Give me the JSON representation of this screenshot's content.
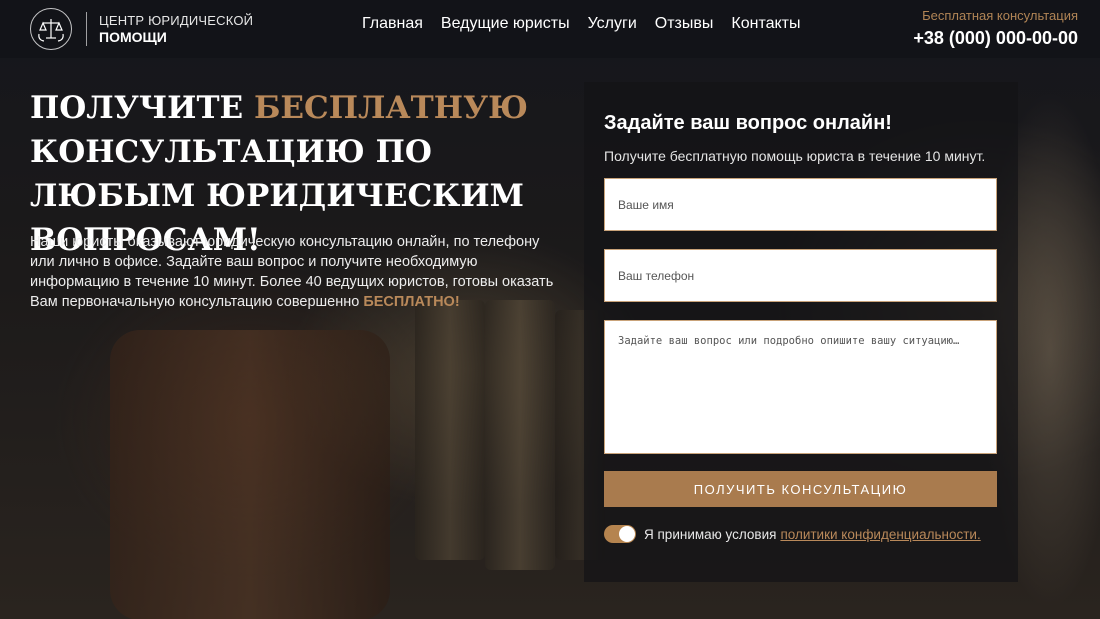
{
  "header": {
    "logo": {
      "line1": "ЦЕНТР ЮРИДИЧЕСКОЙ",
      "line2": "ПОМОЩИ",
      "icon": "scales-of-justice-icon"
    },
    "nav": [
      {
        "label": "Главная"
      },
      {
        "label": "Ведущие юристы"
      },
      {
        "label": "Услуги"
      },
      {
        "label": "Отзывы"
      },
      {
        "label": "Контакты"
      }
    ],
    "contact": {
      "label": "Бесплатная консультация",
      "phone": "+38 (000) 000-00-00"
    }
  },
  "hero": {
    "title_part1": "ПОЛУЧИТЕ ",
    "title_accent": "БЕСПЛАТНУЮ",
    "title_part2": " КОНСУЛЬТАЦИЮ ПО ЛЮБЫМ ЮРИДИЧЕСКИМ ВОПРОСАМ!",
    "description": "Наши юристы оказывают юридическую консультацию онлайн, по телефону или лично в офисе. Задайте ваш вопрос и получите необходимую информацию в течение 10 минут. Более 40 ведущих юристов, готовы оказать Вам первоначальную консультацию совершенно ",
    "description_accent": "БЕСПЛАТНО!"
  },
  "form": {
    "title": "Задайте ваш вопрос онлайн!",
    "subtitle": "Получите бесплатную помощь юриста в течение 10 минут.",
    "name_placeholder": "Ваше имя",
    "phone_placeholder": "Ваш телефон",
    "question_placeholder": "Задайте ваш вопрос или подробно опишите вашу ситуацию…",
    "submit_label": "ПОЛУЧИТЬ КОНСУЛЬТАЦИЮ",
    "consent_text": "Я принимаю условия",
    "consent_link": "политики конфиденциальности.",
    "consent_checked": true
  },
  "colors": {
    "accent": "#b08455",
    "header_bg": "#121318",
    "button_bg": "#a97b4e"
  }
}
